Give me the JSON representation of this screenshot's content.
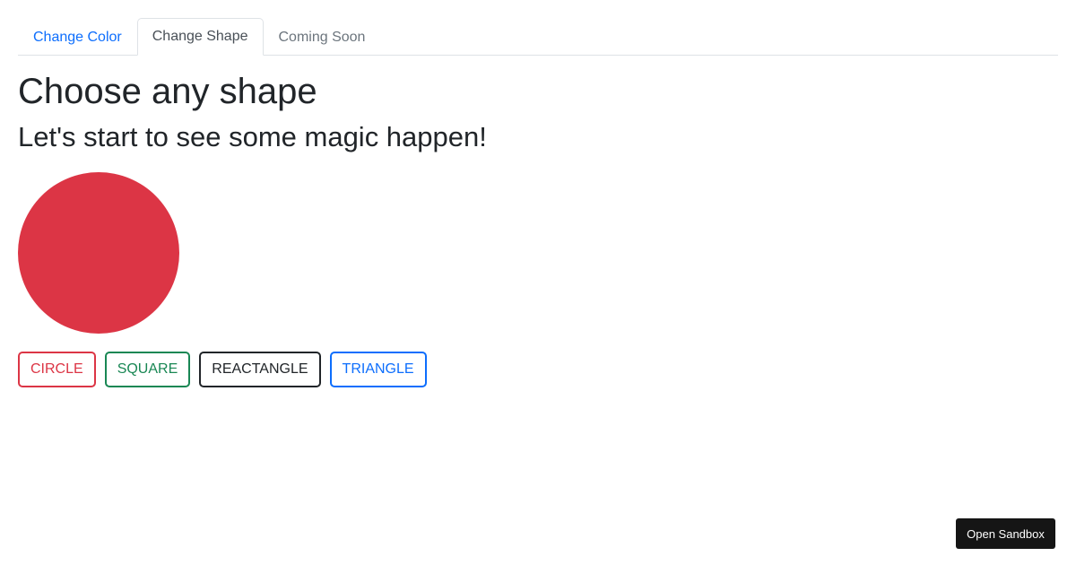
{
  "tabs": [
    {
      "label": "Change Color",
      "state": "link"
    },
    {
      "label": "Change Shape",
      "state": "active"
    },
    {
      "label": "Coming Soon",
      "state": "disabled"
    }
  ],
  "main": {
    "title": "Choose any shape",
    "subtitle": "Let's start to see some magic happen!",
    "shape": {
      "type": "circle",
      "color": "#dc3545"
    }
  },
  "buttons": [
    {
      "label": "CIRCLE",
      "color": "#dc3545"
    },
    {
      "label": "SQUARE",
      "color": "#198754"
    },
    {
      "label": "REACTANGLE",
      "color": "#212529"
    },
    {
      "label": "TRIANGLE",
      "color": "#0d6efd"
    }
  ],
  "sandbox": {
    "label": "Open Sandbox"
  }
}
